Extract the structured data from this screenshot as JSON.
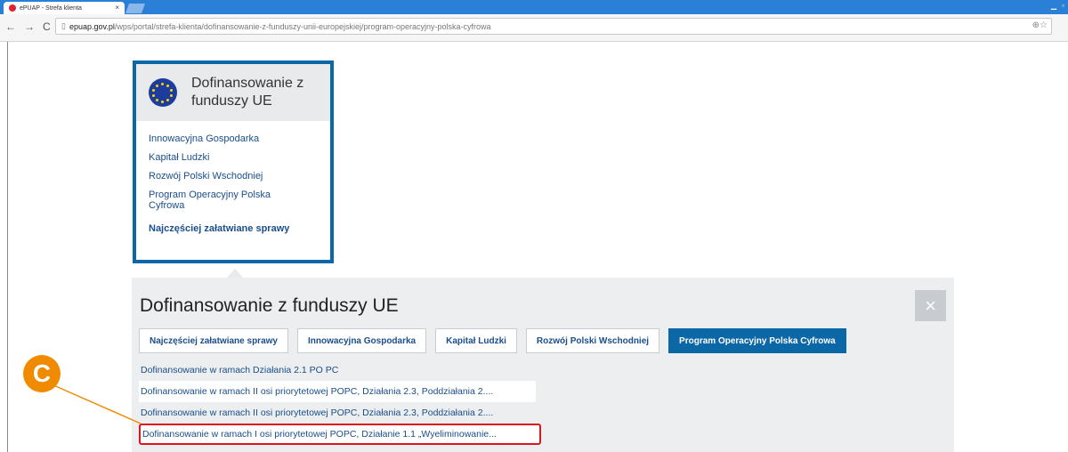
{
  "browser": {
    "tab_title": "ePUAP - Strefa klienta",
    "tab_close": "×",
    "url_host": "epuap.gov.pl",
    "url_path": "/wps/portal/strefa-klienta/dofinansowanie-z-funduszy-unii-europejskiej/program-operacyjny-polska-cyfrowa",
    "back": "←",
    "forward": "→",
    "reload": "C"
  },
  "card": {
    "title_line1": "Dofinansowanie z",
    "title_line2": "funduszy UE",
    "links": [
      "Innowacyjna Gospodarka",
      "Kapitał Ludzki",
      "Rozwój Polski Wschodniej",
      "Program Operacyjny Polska Cyfrowa"
    ],
    "bold_link": "Najczęściej załatwiane sprawy"
  },
  "panel": {
    "title": "Dofinansowanie z funduszy UE",
    "close": "×",
    "tabs": [
      "Najczęściej załatwiane sprawy",
      "Innowacyjna Gospodarka",
      "Kapitał Ludzki",
      "Rozwój Polski Wschodniej",
      "Program Operacyjny Polska Cyfrowa"
    ],
    "active_tab": "Program Operacyjny Polska Cyfrowa",
    "items": [
      "Dofinansowanie w ramach Działania 2.1 PO PC",
      "Dofinansowanie w ramach II osi priorytetowej POPC, Działania 2.3, Poddziałania 2....",
      "Dofinansowanie w ramach II osi priorytetowej POPC, Działania 2.3, Poddziałania 2....",
      "Dofinansowanie w ramach I osi priorytetowej POPC, Działanie 1.1 „Wyeliminowanie..."
    ]
  },
  "callout": {
    "label": "C"
  },
  "colors": {
    "primary": "#0c67a6",
    "highlight": "#e0141f",
    "callout": "#f08a00"
  }
}
